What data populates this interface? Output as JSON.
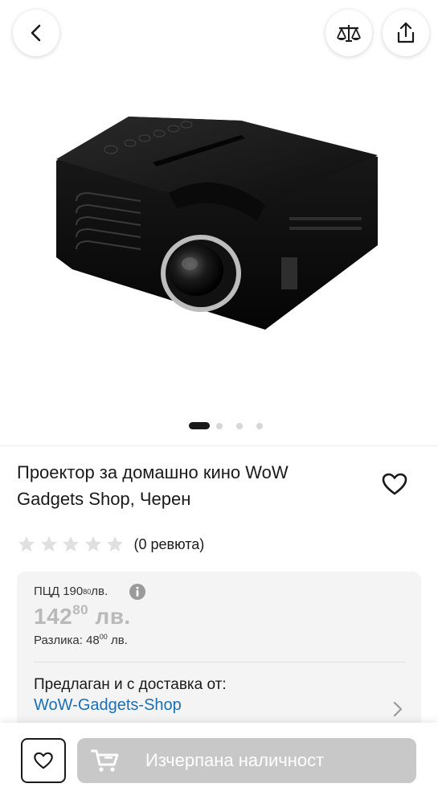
{
  "header": {
    "back_icon": "chevron-left-icon",
    "compare_icon": "scales-icon",
    "share_icon": "share-icon"
  },
  "gallery": {
    "image": "black mini projector product photo",
    "dots_count": 4,
    "active_dot": 0
  },
  "product": {
    "title": "Проектор за домашно кино WoW Gadgets Shop, Черен",
    "rating_stars": 0,
    "rating_max": 5,
    "reviews_text": "(0 ревюта)"
  },
  "pricing": {
    "rrp_label": "ПЦД 190",
    "rrp_cents": "80",
    "rrp_currency": " лв.",
    "price_main": "142",
    "price_cents": "80",
    "price_currency": " лв.",
    "diff_label": "Разлика: 48",
    "diff_cents": "00",
    "diff_currency": " лв.",
    "offered_label": "Предлаган и с доставка от:",
    "seller_name": "WoW-Gadgets-Shop"
  },
  "bottom": {
    "out_of_stock_label": "Изчерпана наличност"
  },
  "colors": {
    "accent_link": "#1a6fb5",
    "disabled_button": "#c8c8c8",
    "card_bg": "#f4f4f4"
  }
}
